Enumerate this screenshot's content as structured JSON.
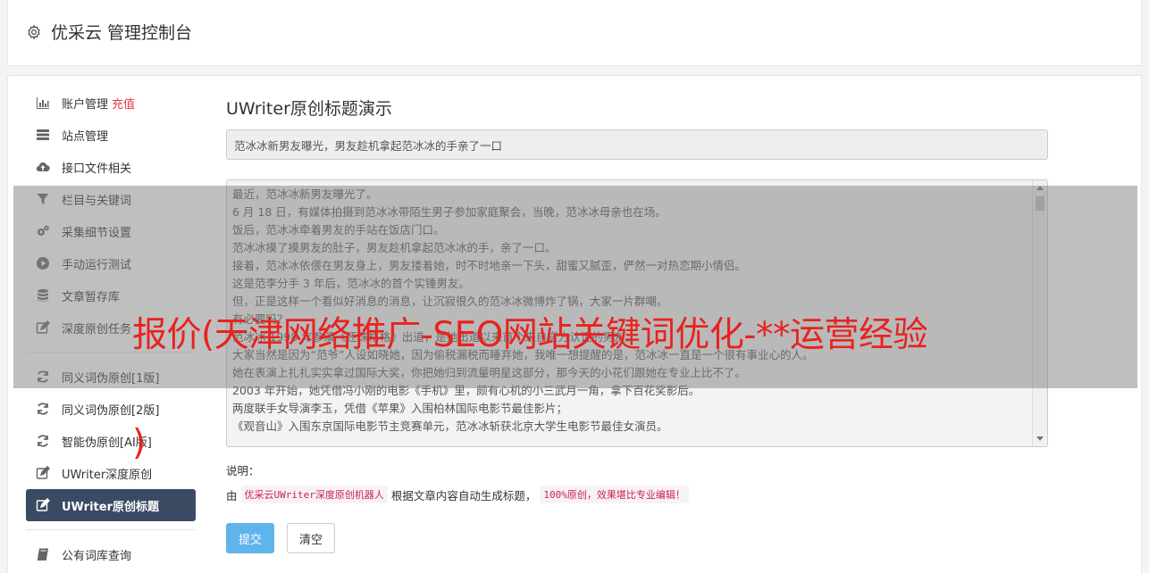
{
  "header": {
    "title": "优采云 管理控制台"
  },
  "sidebar": {
    "items": [
      {
        "label": "账户管理",
        "badge": "充值",
        "icon": "bar-chart-icon"
      },
      {
        "label": "站点管理",
        "icon": "server-icon"
      },
      {
        "label": "接口文件相关",
        "icon": "cloud-upload-icon"
      },
      {
        "label": "栏目与关键词",
        "icon": "filter-icon"
      },
      {
        "label": "采集细节设置",
        "icon": "gears-icon"
      },
      {
        "label": "手动运行测试",
        "icon": "play-circle-icon"
      },
      {
        "label": "文章暂存库",
        "icon": "database-icon"
      },
      {
        "label": "深度原创任务",
        "icon": "edit-icon"
      },
      {
        "label": "同义词伪原创[1版]",
        "icon": "refresh-icon"
      },
      {
        "label": "同义词伪原创[2版]",
        "icon": "refresh-icon"
      },
      {
        "label": "智能伪原创[AI版]",
        "icon": "refresh-icon"
      },
      {
        "label": "UWriter深度原创",
        "icon": "edit-icon"
      },
      {
        "label": "UWriter原创标题",
        "icon": "edit-icon"
      },
      {
        "label": "公有词库查询",
        "icon": "book-icon"
      }
    ]
  },
  "main": {
    "heading": "UWriter原创标题演示",
    "title_value": "范冰冰新男友曝光，男友趁机拿起范冰冰的手亲了一口",
    "article_lines": [
      "最近，范冰冰新男友曝光了。",
      "6 月 18 日，有媒体拍摄到范冰冰带陌生男子参加家庭聚会，当晚，范冰冰母亲也在场。",
      "饭后，范冰冰牵着男友的手站在饭店门口。",
      "范冰冰摸了摸男友的肚子，男友趁机拿起范冰冰的手，亲了一口。",
      "接着，范冰冰依偎在男友身上，男友搂着她，时不时地亲一下头，甜蜜又腻歪，俨然一对热恋期小情侣。",
      "这是范李分手 3 年后，范冰冰的首个实锤男友。",
      "但，正是这样一个看似好消息的消息，让沉寂很久的范冰冰微博炸了锅，大家一片群嘲。",
      "有必要吗？",
      "范冰冰 1998 年参演《还珠格格》出道，是她出道以来首个来自官方认证的男友。",
      "大家当然是因为“范爷”人设如晓她，因为偷税漏税而睡弃她，我唯一想提醒的是，范冰冰一直是一个很有事业心的人。",
      "她在表演上扎扎实实拿过国际大奖，你把她归到流量明星这部分，那今天的小花们跟她在专业上比不了。",
      "2003 年开始，她凭借冯小刚的电影《手机》里，颇有心机的小三武月一角，拿下百花奖影后。",
      "两度联手女导演李玉，凭借《苹果》入围柏林国际电影节最佳影片；",
      "《观音山》入围东京国际电影节主竞赛单元，范冰冰斩获北京大学生电影节最佳女演员。"
    ],
    "note_label": "说明：",
    "note_prefix": "由",
    "note_code1": "优采云UWriter深度原创机器人",
    "note_middle": "根据文章内容自动生成标题，",
    "note_code2": "100%原创，效果堪比专业编辑！",
    "submit_label": "提交",
    "clear_label": "清空"
  },
  "watermark": {
    "line1": "报价(天津网络推广-SEO网站关键词优化-**运营经验",
    "line2": ")"
  },
  "colors": {
    "active_nav": "#3b4a63",
    "primary_button": "#5fb4ec",
    "watermark": "#e8231f",
    "badge": "#e4393c"
  }
}
